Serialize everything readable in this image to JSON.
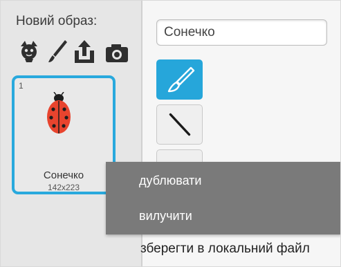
{
  "costumes_panel": {
    "new_costume_label": "Новий образ:",
    "tools": [
      {
        "name": "choose-from-library",
        "icon": "sprite-library-icon"
      },
      {
        "name": "paint-new",
        "icon": "paintbrush-icon"
      },
      {
        "name": "upload-from-file",
        "icon": "upload-icon"
      },
      {
        "name": "take-photo",
        "icon": "camera-icon"
      }
    ],
    "costume": {
      "index": "1",
      "name": "Сонечко",
      "size": "142x223",
      "thumbnail": "ladybug"
    }
  },
  "editor": {
    "costume_name_value": "Сонечко",
    "tools": [
      {
        "name": "brush",
        "icon": "brush-icon",
        "selected": true
      },
      {
        "name": "line",
        "icon": "line-icon",
        "selected": false
      },
      {
        "name": "rectangle",
        "icon": "rectangle-icon",
        "selected": false
      }
    ]
  },
  "context_menu": {
    "items": [
      "дублювати",
      "вилучити",
      "зберегти в локальний файл"
    ]
  },
  "colors": {
    "accent": "#29a9dd",
    "menu_background": "#7a7a7a",
    "ladybug_red": "#e8442e"
  }
}
